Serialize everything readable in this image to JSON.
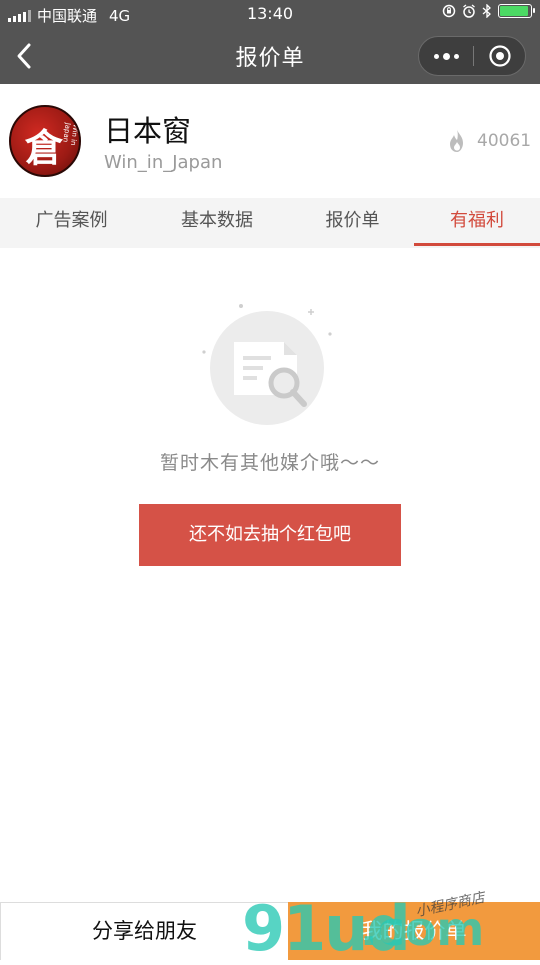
{
  "status_bar": {
    "carrier": "中国联通",
    "network": "4G",
    "time": "13:40"
  },
  "nav": {
    "title": "报价单"
  },
  "profile": {
    "name": "日本窗",
    "handle": "Win_in_Japan",
    "logo_mark": "倉",
    "logo_script": "Win in Japan",
    "hot_count": "40061"
  },
  "tabs": [
    {
      "label": "广告案例",
      "active": false
    },
    {
      "label": "基本数据",
      "active": false
    },
    {
      "label": "报价单",
      "active": false
    },
    {
      "label": "有福利",
      "active": true
    }
  ],
  "empty_state": {
    "message": "暂时木有其他媒介哦～～",
    "action_label": "还不如去抽个红包吧"
  },
  "bottom_bar": {
    "share_label": "分享给朋友",
    "my_quote_label": "我的报价单"
  },
  "watermark": {
    "text": "91ud",
    "suffix": ".com",
    "tag": "小程序商店"
  },
  "colors": {
    "header_bg": "#545454",
    "accent_red": "#d24a3c",
    "button_red": "#d55247",
    "bottom_orange": "#f29a3e",
    "battery_green": "#4cd964"
  }
}
